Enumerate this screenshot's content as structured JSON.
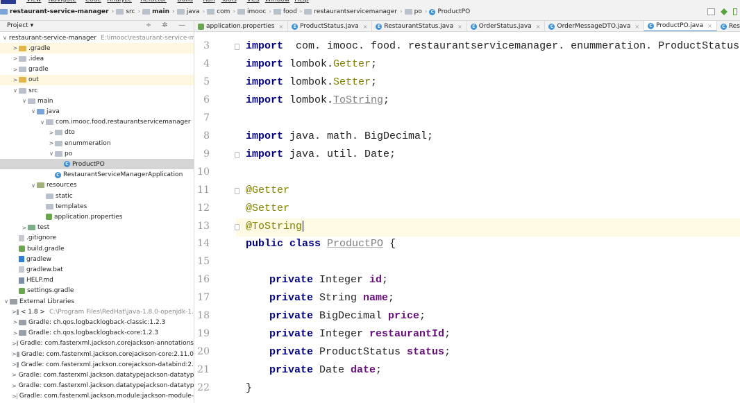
{
  "menubar": [
    "View",
    "Navigate",
    "Code",
    "Analyze",
    "Refactor",
    "Build",
    "Run",
    "Tools",
    "VCS",
    "Window",
    "Help"
  ],
  "breadcrumbs": [
    {
      "label": "restaurant-service-manager",
      "icon": "module-folder-icon",
      "bold": true
    },
    {
      "label": "src",
      "icon": "folder-icon"
    },
    {
      "label": "main",
      "icon": "folder-icon",
      "bold": true
    },
    {
      "label": "java",
      "icon": "folder-icon"
    },
    {
      "label": "com",
      "icon": "package-icon"
    },
    {
      "label": "imooc",
      "icon": "package-icon"
    },
    {
      "label": "food",
      "icon": "package-icon"
    },
    {
      "label": "restaurantservicemanager",
      "icon": "package-icon"
    },
    {
      "label": "po",
      "icon": "package-icon"
    },
    {
      "label": "ProductPO",
      "icon": "class-icon"
    }
  ],
  "project_panel": {
    "label": "Project ▾",
    "tools": "÷ ✲ —"
  },
  "tabs": [
    {
      "label": "application.properties",
      "icon": "properties-icon",
      "active": false
    },
    {
      "label": "ProductStatus.java",
      "icon": "enum-icon",
      "active": false
    },
    {
      "label": "RestaurantStatus.java",
      "icon": "enum-icon",
      "active": false
    },
    {
      "label": "OrderStatus.java",
      "icon": "enum-icon",
      "active": false
    },
    {
      "label": "OrderMessageDTO.java",
      "icon": "class-icon",
      "active": false
    },
    {
      "label": "ProductPO.java",
      "icon": "class-icon",
      "active": true
    },
    {
      "label": "RestaurantServi",
      "icon": "class-icon",
      "active": false
    }
  ],
  "tree": [
    {
      "indent": 0,
      "arrow": "∨",
      "icon": "module-folder-icon",
      "label": "restaurant-service-manager",
      "path": "E:\\imooc\\restaurant-service-m"
    },
    {
      "indent": 1,
      "arrow": ">",
      "icon": "folder-yellow-icon",
      "label": ".gradle",
      "bg": "yellow"
    },
    {
      "indent": 1,
      "arrow": ">",
      "icon": "folder-icon",
      "label": ".idea"
    },
    {
      "indent": 1,
      "arrow": ">",
      "icon": "folder-icon",
      "label": "gradle"
    },
    {
      "indent": 1,
      "arrow": ">",
      "icon": "folder-yellow-icon",
      "label": "out",
      "bg": "yellow"
    },
    {
      "indent": 1,
      "arrow": "∨",
      "icon": "folder-icon",
      "label": "src"
    },
    {
      "indent": 2,
      "arrow": "∨",
      "icon": "folder-icon",
      "label": "main"
    },
    {
      "indent": 3,
      "arrow": "∨",
      "icon": "folder-blue-icon",
      "label": "java"
    },
    {
      "indent": 4,
      "arrow": "∨",
      "icon": "package-icon",
      "label": "com.imooc.food.restaurantservicemanager"
    },
    {
      "indent": 5,
      "arrow": ">",
      "icon": "package-icon",
      "label": "dto"
    },
    {
      "indent": 5,
      "arrow": ">",
      "icon": "package-icon",
      "label": "enummeration"
    },
    {
      "indent": 5,
      "arrow": "∨",
      "icon": "package-icon",
      "label": "po"
    },
    {
      "indent": 6,
      "arrow": "",
      "icon": "class-icon",
      "label": "ProductPO",
      "selected": true
    },
    {
      "indent": 5,
      "arrow": "",
      "icon": "spring-class-icon",
      "label": "RestaurantServiceManagerApplication"
    },
    {
      "indent": 3,
      "arrow": "∨",
      "icon": "resources-folder-icon",
      "label": "resources"
    },
    {
      "indent": 4,
      "arrow": "",
      "icon": "folder-icon",
      "label": "static"
    },
    {
      "indent": 4,
      "arrow": "",
      "icon": "folder-icon",
      "label": "templates"
    },
    {
      "indent": 4,
      "arrow": "",
      "icon": "properties-icon",
      "label": "application.properties"
    },
    {
      "indent": 2,
      "arrow": ">",
      "icon": "test-folder-icon",
      "label": "test"
    },
    {
      "indent": 1,
      "arrow": "",
      "icon": "file-icon",
      "label": ".gitignore"
    },
    {
      "indent": 1,
      "arrow": "",
      "icon": "gradle-icon",
      "label": "build.gradle"
    },
    {
      "indent": 1,
      "arrow": "",
      "icon": "gradlew-icon",
      "label": "gradlew"
    },
    {
      "indent": 1,
      "arrow": "",
      "icon": "file-icon",
      "label": "gradlew.bat"
    },
    {
      "indent": 1,
      "arrow": "",
      "icon": "markdown-icon",
      "label": "HELP.md"
    },
    {
      "indent": 1,
      "arrow": "",
      "icon": "gradle-icon",
      "label": "settings.gradle"
    },
    {
      "indent": 0,
      "arrow": "∨",
      "icon": "library-icon",
      "label": "External Libraries"
    },
    {
      "indent": 1,
      "arrow": ">",
      "icon": "jdk-icon",
      "label": "< 1.8 >",
      "path": "C:\\Program Files\\RedHat\\java-1.8.0-openjdk-1."
    },
    {
      "indent": 1,
      "arrow": ">",
      "icon": "library-icon",
      "label": "Gradle: ch.qos.logbacklogback-classic:1.2.3"
    },
    {
      "indent": 1,
      "arrow": ">",
      "icon": "library-icon",
      "label": "Gradle: ch.qos.logbacklogback-core:1.2.3"
    },
    {
      "indent": 1,
      "arrow": ">",
      "icon": "library-icon",
      "label": "Gradle: com.fasterxml.jackson.corejackson-annotations"
    },
    {
      "indent": 1,
      "arrow": ">",
      "icon": "library-icon",
      "label": "Gradle: com.fasterxml.jackson.corejackson-core:2.11.0"
    },
    {
      "indent": 1,
      "arrow": ">",
      "icon": "library-icon",
      "label": "Gradle: com.fasterxml.jackson.corejackson-databind:2."
    },
    {
      "indent": 1,
      "arrow": ">",
      "icon": "library-icon",
      "label": "Gradle: com.fasterxml.jackson.datatypejackson-datatyp"
    },
    {
      "indent": 1,
      "arrow": ">",
      "icon": "library-icon",
      "label": "Gradle: com.fasterxml.jackson.datatypejackson-datatyp"
    },
    {
      "indent": 1,
      "arrow": ">",
      "icon": "library-icon",
      "label": "Gradle: com.fasterxml.jackson.module:jackson-module-"
    }
  ],
  "editor": {
    "current_line": 13,
    "lines": [
      {
        "n": "3",
        "tokens": [
          [
            "kw",
            "import"
          ],
          [
            "",
            "  com. imooc. food. restaurantservicemanager. enummeration. ProductStatus;"
          ]
        ]
      },
      {
        "n": "4",
        "tokens": [
          [
            "kw",
            "import"
          ],
          [
            "",
            " lombok."
          ],
          [
            "gr",
            "Getter"
          ],
          [
            "",
            ";"
          ]
        ]
      },
      {
        "n": "5",
        "tokens": [
          [
            "kw",
            "import"
          ],
          [
            "",
            " lombok."
          ],
          [
            "gr",
            "Setter"
          ],
          [
            "",
            ";"
          ]
        ]
      },
      {
        "n": "6",
        "tokens": [
          [
            "kw",
            "import"
          ],
          [
            "",
            " lombok."
          ],
          [
            "ul",
            "ToString"
          ],
          [
            "",
            ";"
          ]
        ]
      },
      {
        "n": "7",
        "tokens": []
      },
      {
        "n": "8",
        "tokens": [
          [
            "kw",
            "import"
          ],
          [
            "",
            " java. math. BigDecimal;"
          ]
        ]
      },
      {
        "n": "9",
        "tokens": [
          [
            "kw",
            "import"
          ],
          [
            "",
            " java. util. Date;"
          ]
        ]
      },
      {
        "n": "10",
        "tokens": []
      },
      {
        "n": "11",
        "tokens": [
          [
            "ann",
            "@Getter"
          ]
        ]
      },
      {
        "n": "12",
        "tokens": [
          [
            "ann",
            "@Setter"
          ]
        ]
      },
      {
        "n": "13",
        "tokens": [
          [
            "ann",
            "@ToString"
          ]
        ],
        "caret": true
      },
      {
        "n": "14",
        "tokens": [
          [
            "kw",
            "public class"
          ],
          [
            "",
            " "
          ],
          [
            "ul",
            "ProductPO"
          ],
          [
            "",
            " {"
          ]
        ]
      },
      {
        "n": "15",
        "tokens": []
      },
      {
        "n": "16",
        "indent": true,
        "tokens": [
          [
            "kw",
            "private"
          ],
          [
            "",
            " Integer "
          ],
          [
            "fld",
            "id"
          ],
          [
            "",
            ";"
          ]
        ]
      },
      {
        "n": "17",
        "indent": true,
        "tokens": [
          [
            "kw",
            "private"
          ],
          [
            "",
            " String "
          ],
          [
            "fld",
            "name"
          ],
          [
            "",
            ";"
          ]
        ]
      },
      {
        "n": "18",
        "indent": true,
        "tokens": [
          [
            "kw",
            "private"
          ],
          [
            "",
            " BigDecimal "
          ],
          [
            "fld",
            "price"
          ],
          [
            "",
            ";"
          ]
        ]
      },
      {
        "n": "19",
        "indent": true,
        "tokens": [
          [
            "kw",
            "private"
          ],
          [
            "",
            " Integer "
          ],
          [
            "fld",
            "restaurantId"
          ],
          [
            "",
            ";"
          ]
        ]
      },
      {
        "n": "20",
        "indent": true,
        "tokens": [
          [
            "kw",
            "private"
          ],
          [
            "",
            " ProductStatus "
          ],
          [
            "fld",
            "status"
          ],
          [
            "",
            ";"
          ]
        ]
      },
      {
        "n": "21",
        "indent": true,
        "tokens": [
          [
            "kw",
            "private"
          ],
          [
            "",
            " Date "
          ],
          [
            "fld",
            "date"
          ],
          [
            "",
            ";"
          ]
        ]
      },
      {
        "n": "22",
        "tokens": [
          [
            "",
            "}"
          ]
        ]
      }
    ]
  }
}
